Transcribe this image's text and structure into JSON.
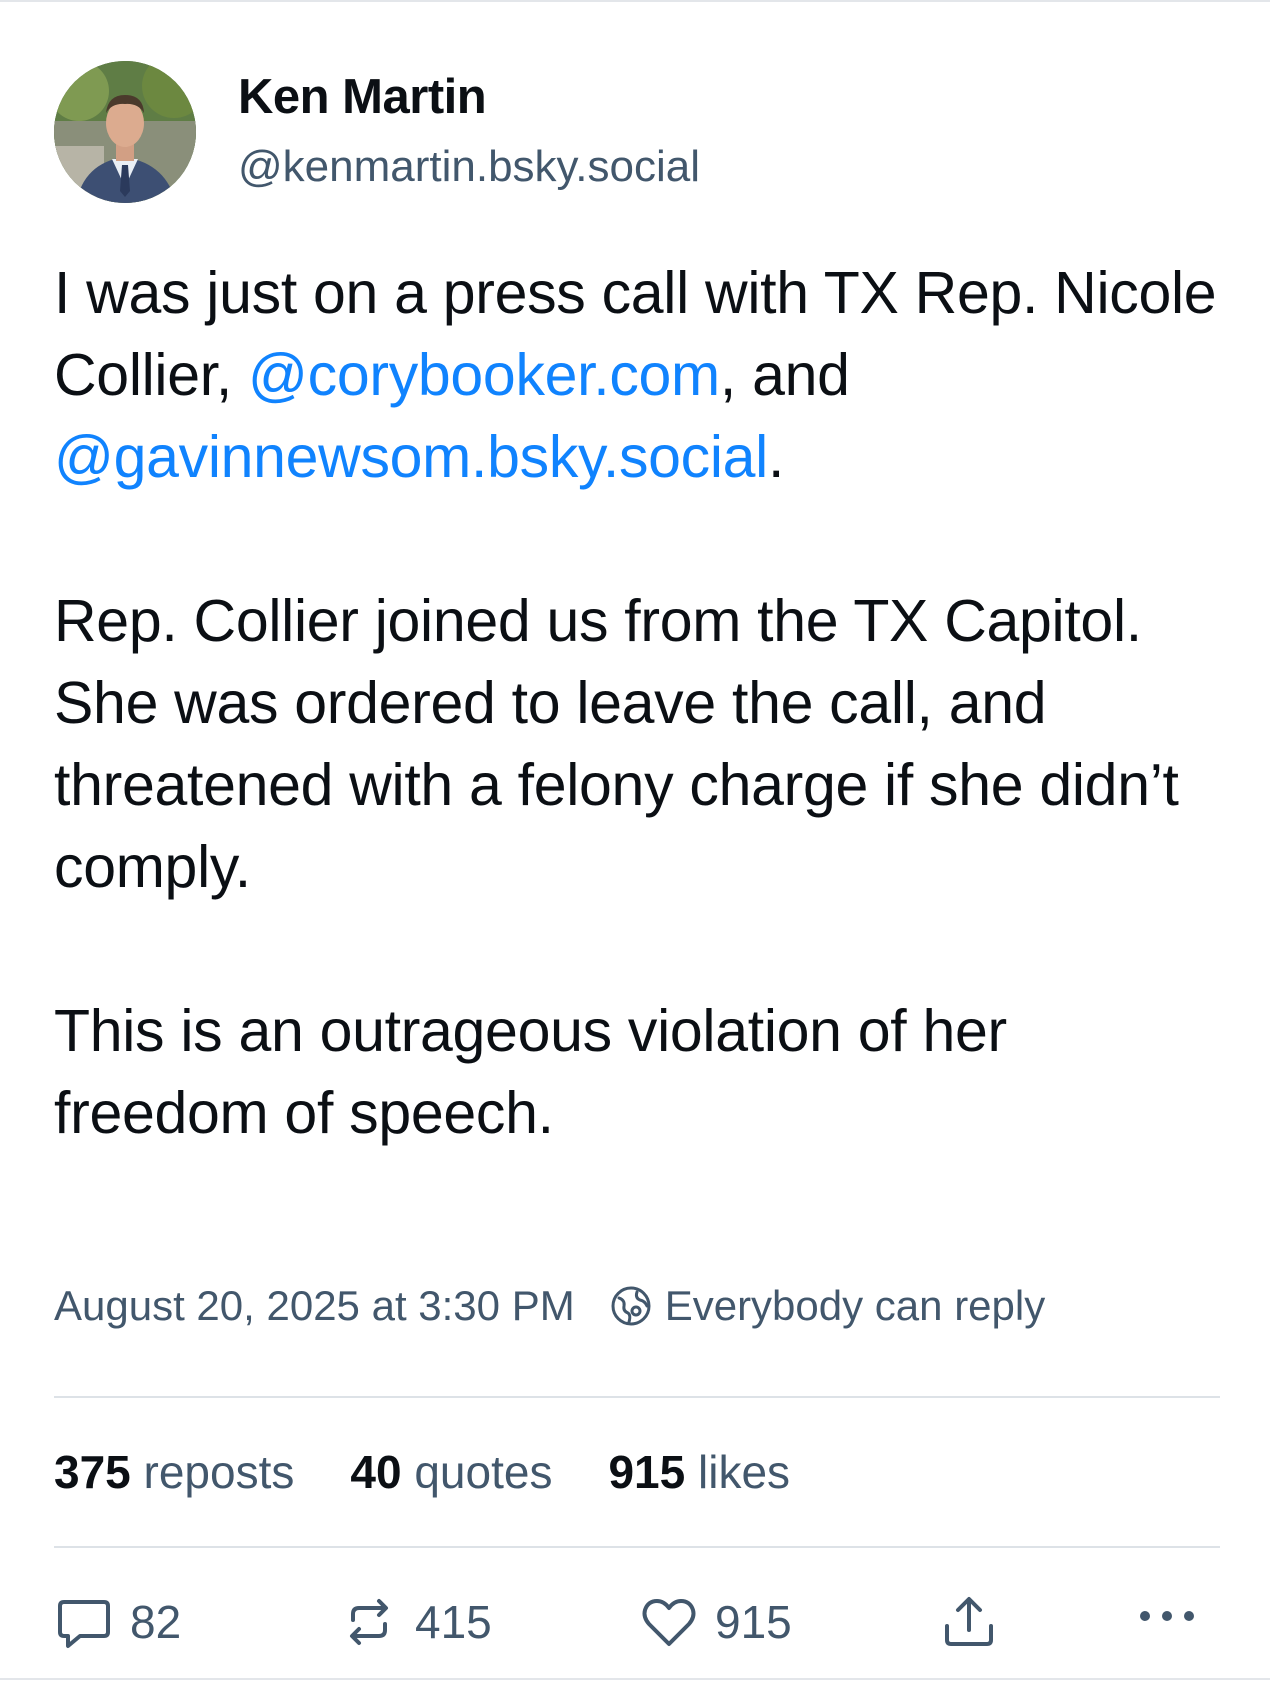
{
  "author": {
    "display_name": "Ken Martin",
    "handle": "@kenmartin.bsky.social"
  },
  "post": {
    "paragraphs": [
      {
        "p1_text_a": "I was just on a press call with TX Rep. Nicole Collier, ",
        "p1_mention_1": "@corybooker.com",
        "p1_text_b": ", and ",
        "p1_mention_2": "@gavinnewsom.bsky.social",
        "p1_text_c": "."
      }
    ],
    "p2": "Rep. Collier joined us from the TX Capitol. She was ordered to leave the call, and threatened with a felony charge if she didn’t comply.",
    "p3": "This is an outrageous violation of her freedom of speech.",
    "timestamp": "August 20, 2025 at 3:30 PM",
    "reply_setting": "Everybody can reply"
  },
  "stats": {
    "reposts_count": "375",
    "reposts_label": "reposts",
    "quotes_count": "40",
    "quotes_label": "quotes",
    "likes_count": "915",
    "likes_label": "likes"
  },
  "actions": {
    "reply_count": "82",
    "repost_count": "415",
    "like_count": "915"
  },
  "colors": {
    "text": "#0b0f14",
    "muted": "#42576c",
    "link": "#1083fe",
    "divider": "#dde2e7"
  },
  "icons": {
    "reply": "reply-icon",
    "repost": "repost-icon",
    "like": "heart-icon",
    "share": "share-icon",
    "more": "more-icon",
    "reply_setting": "globe-icon"
  }
}
